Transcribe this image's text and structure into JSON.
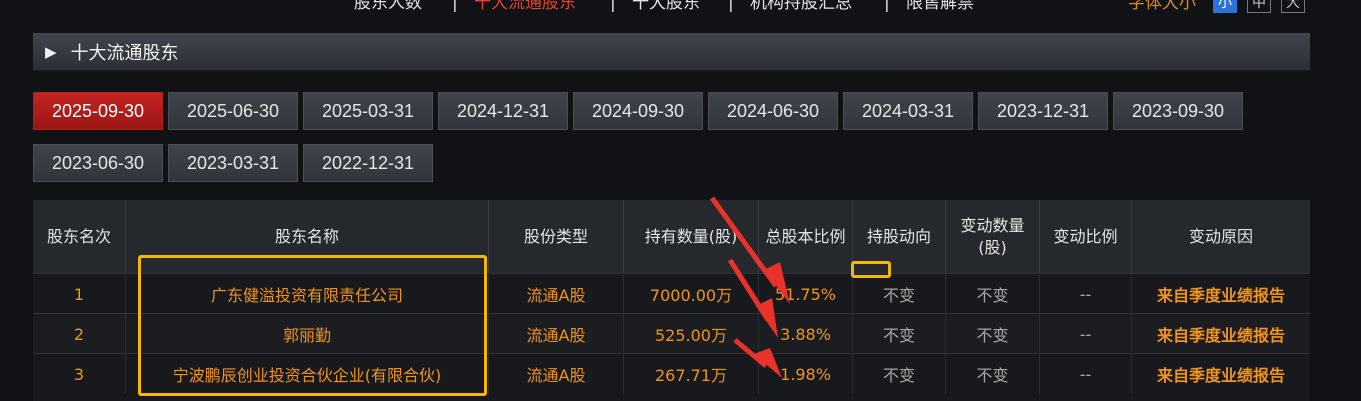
{
  "topnav": {
    "items": [
      "股东人数",
      "十大流通股东",
      "十大股东",
      "机构持股汇总",
      "限售解禁"
    ],
    "active_index": 1,
    "font_size_label": "字体大小",
    "font_sizes": [
      "小",
      "中",
      "大"
    ],
    "font_size_active": 0
  },
  "section": {
    "title": "十大流通股东"
  },
  "dates": [
    "2025-09-30",
    "2025-06-30",
    "2025-03-31",
    "2024-12-31",
    "2024-09-30",
    "2024-06-30",
    "2024-03-31",
    "2023-12-31",
    "2023-09-30",
    "2023-06-30",
    "2023-03-31",
    "2022-12-31"
  ],
  "date_active_index": 0,
  "table": {
    "headers": [
      "股东名次",
      "股东名称",
      "股份类型",
      "持有数量(股)",
      "总股本比例",
      "持股动向",
      "变动数量(股)",
      "变动比例",
      "变动原因"
    ],
    "rows": [
      {
        "rank": "1",
        "name": "广东健溢投资有限责任公司",
        "type": "流通A股",
        "qty": "7000.00万",
        "ratio": "51.75%",
        "direction": "不变",
        "change_qty": "不变",
        "change_ratio": "--",
        "reason": "来自季度业绩报告"
      },
      {
        "rank": "2",
        "name": "郭丽勤",
        "type": "流通A股",
        "qty": "525.00万",
        "ratio": "3.88%",
        "direction": "不变",
        "change_qty": "不变",
        "change_ratio": "--",
        "reason": "来自季度业绩报告"
      },
      {
        "rank": "3",
        "name": "宁波鹏辰创业投资合伙企业(有限合伙)",
        "type": "流通A股",
        "qty": "267.71万",
        "ratio": "1.98%",
        "direction": "不变",
        "change_qty": "不变",
        "change_ratio": "--",
        "reason": "来自季度业绩报告"
      }
    ]
  },
  "colors": {
    "accent_red": "#e8412c",
    "accent_orange": "#f0941e",
    "annotation_yellow": "#f5b800",
    "annotation_arrow": "#e8322a"
  }
}
